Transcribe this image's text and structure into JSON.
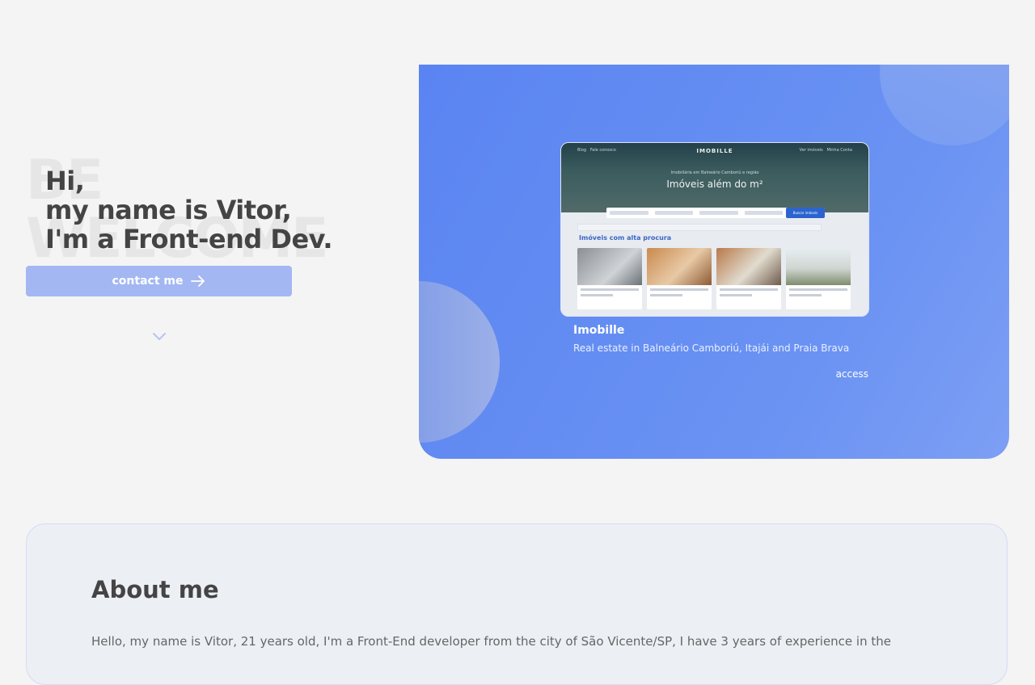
{
  "hero": {
    "bg_word_1": "BE",
    "bg_word_2": "WELCOME",
    "greeting_line_1": "Hi,",
    "greeting_line_2": "my name is Vitor,",
    "greeting_line_3": "I'm a Front-end Dev.",
    "contact_label": "contact me",
    "icons": {
      "contact": "arrow-right-icon",
      "scroll": "chevron-down-icon"
    }
  },
  "showcase": {
    "project": {
      "title": "Imobille",
      "description": "Real estate in Balneário Camboriú, Itajái and Praia Brava",
      "link_label": "access"
    },
    "preview": {
      "logo": "IMOBILLE",
      "nav_left": "Blog",
      "nav_left_2": "Fale conosco",
      "nav_right": "Ver imóveis",
      "nav_right_2": "Minha Conta",
      "subtitle": "Imobiliária em Balneário Camboriú e região",
      "hero_text": "Imóveis além do m²",
      "search_button": "Buscar imóveis",
      "section_title": "Imóveis com alta procura"
    }
  },
  "about": {
    "title": "About me",
    "text": "Hello, my name is Vitor, 21 years old, I'm a Front-End developer from the city of São Vicente/SP, I have 3 years of experience in the"
  },
  "colors": {
    "accent": "#5a84f2",
    "button": "#a3b7f2",
    "background": "#f4f4f4",
    "text": "#444444"
  }
}
